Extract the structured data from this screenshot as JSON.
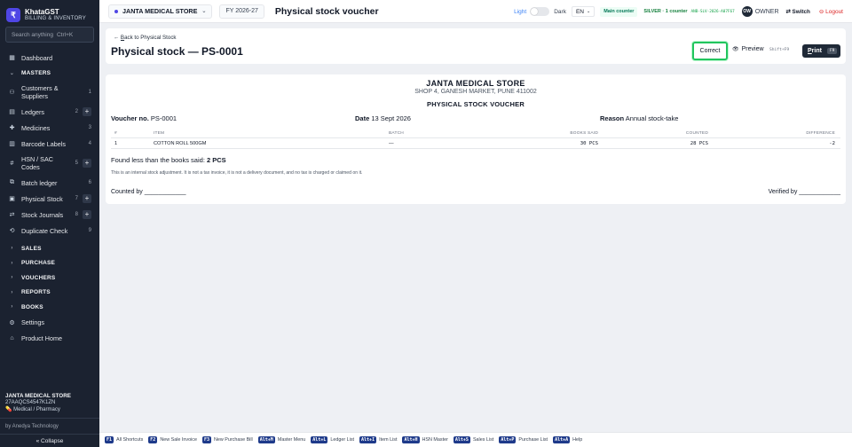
{
  "app": {
    "name": "KhataGST",
    "subtitle": "BILLING & INVENTORY",
    "logo_glyph": "₹"
  },
  "search": {
    "placeholder": "Search anything",
    "shortcut": "Ctrl+K"
  },
  "sidebar": {
    "items": [
      {
        "label": "Dashboard",
        "icon": "grid-icon"
      },
      {
        "label": "MASTERS",
        "icon": "chevron-down-icon"
      },
      {
        "label": "Customers & Suppliers",
        "count": "1",
        "icon": "users-icon"
      },
      {
        "label": "Ledgers",
        "count": "2",
        "plus": "+",
        "icon": "ledger-icon"
      },
      {
        "label": "Medicines",
        "count": "3",
        "icon": "pill-icon"
      },
      {
        "label": "Barcode Labels",
        "count": "4",
        "icon": "barcode-icon"
      },
      {
        "label": "HSN / SAC Codes",
        "count": "5",
        "plus": "+",
        "icon": "hash-icon"
      },
      {
        "label": "Batch ledger",
        "count": "6",
        "icon": "batch-icon"
      },
      {
        "label": "Physical Stock",
        "count": "7",
        "plus": "+",
        "icon": "box-icon"
      },
      {
        "label": "Stock Journals",
        "count": "8",
        "plus": "+",
        "icon": "arrows-icon"
      },
      {
        "label": "Duplicate Check",
        "count": "9",
        "icon": "duplicate-icon"
      }
    ],
    "sections": [
      "SALES",
      "PURCHASE",
      "VOUCHERS",
      "REPORTS",
      "BOOKS"
    ],
    "bottom_items": [
      {
        "label": "Settings",
        "icon": "gear-icon"
      },
      {
        "label": "Product Home",
        "icon": "home-icon"
      }
    ],
    "footer": {
      "store_name": "JANTA MEDICAL STORE",
      "gstin": "27AAQCS4547K1ZN",
      "business_type": "Medical / Pharmacy",
      "by_line": "by Anedya Technology",
      "collapse_label": "« Collapse"
    }
  },
  "topbar": {
    "store_name": "JANTA MEDICAL STORE",
    "fy": "FY 2026-27",
    "title": "Physical stock voucher",
    "theme_light": "Light",
    "theme_dark": "Dark",
    "language": "EN",
    "counter": "Main counter",
    "license": "SILVER · 1 counter",
    "license_code": "ANB-SLV-2026-A07F67",
    "avatar_initials": "OW",
    "role": "OWNER",
    "switch_label": "⇄ Switch",
    "logout_label": "⊖ Logout"
  },
  "page": {
    "back_prefix": "← ",
    "back_underlined": "B",
    "back_rest": "ack to Physical Stock",
    "title": "Physical stock — PS-0001",
    "correct_label": "Correct",
    "preview_label": "Preview",
    "preview_shortcut": "Shift+F9",
    "print_underlined": "P",
    "print_rest": "rint",
    "print_shortcut": "F9"
  },
  "voucher": {
    "store_name": "JANTA MEDICAL STORE",
    "address": "SHOP 4, GANESH MARKET, PUNE 411002",
    "heading": "PHYSICAL STOCK VOUCHER",
    "voucher_no_label": "Voucher no.",
    "voucher_no": "PS-0001",
    "date_label": "Date",
    "date": "13 Sept 2026",
    "reason_label": "Reason",
    "reason": "Annual stock-take",
    "columns": [
      "#",
      "ITEM",
      "BATCH",
      "BOOKS SAID",
      "COUNTED",
      "DIFFERENCE"
    ],
    "rows": [
      {
        "no": "1",
        "item": "COTTON ROLL 500GM",
        "batch": "—",
        "books_said": "30 PCS",
        "counted": "28 PCS",
        "difference": "-2"
      }
    ],
    "found_text": "Found less than the books said:",
    "found_value": "2 PCS",
    "note": "This is an internal stock adjustment. It is not a tax invoice, it is not a delivery document, and no tax is charged or claimed on it.",
    "counted_by": "Counted by ____________",
    "verified_by": "Verified by ____________"
  },
  "shortcuts": [
    {
      "key": "F1",
      "label": "All Shortcuts"
    },
    {
      "key": "F2",
      "label": "New Sale Invoice"
    },
    {
      "key": "F3",
      "label": "New Purchase Bill"
    },
    {
      "key": "Alt+M",
      "label": "Master Menu"
    },
    {
      "key": "Alt+L",
      "label": "Ledger List"
    },
    {
      "key": "Alt+I",
      "label": "Item List"
    },
    {
      "key": "Alt+H",
      "label": "HSN Master"
    },
    {
      "key": "Alt+S",
      "label": "Sales List"
    },
    {
      "key": "Alt+P",
      "label": "Purchase List"
    },
    {
      "key": "Alt+A",
      "label": "Help"
    }
  ],
  "colors": {
    "sidebar_bg": "#1b2230",
    "accent": "#4f46e5",
    "correct_outline": "#22c55e",
    "print_bg": "#1f2937",
    "shortcut_key_bg": "#1e3a8a",
    "logout": "#dc2626"
  }
}
